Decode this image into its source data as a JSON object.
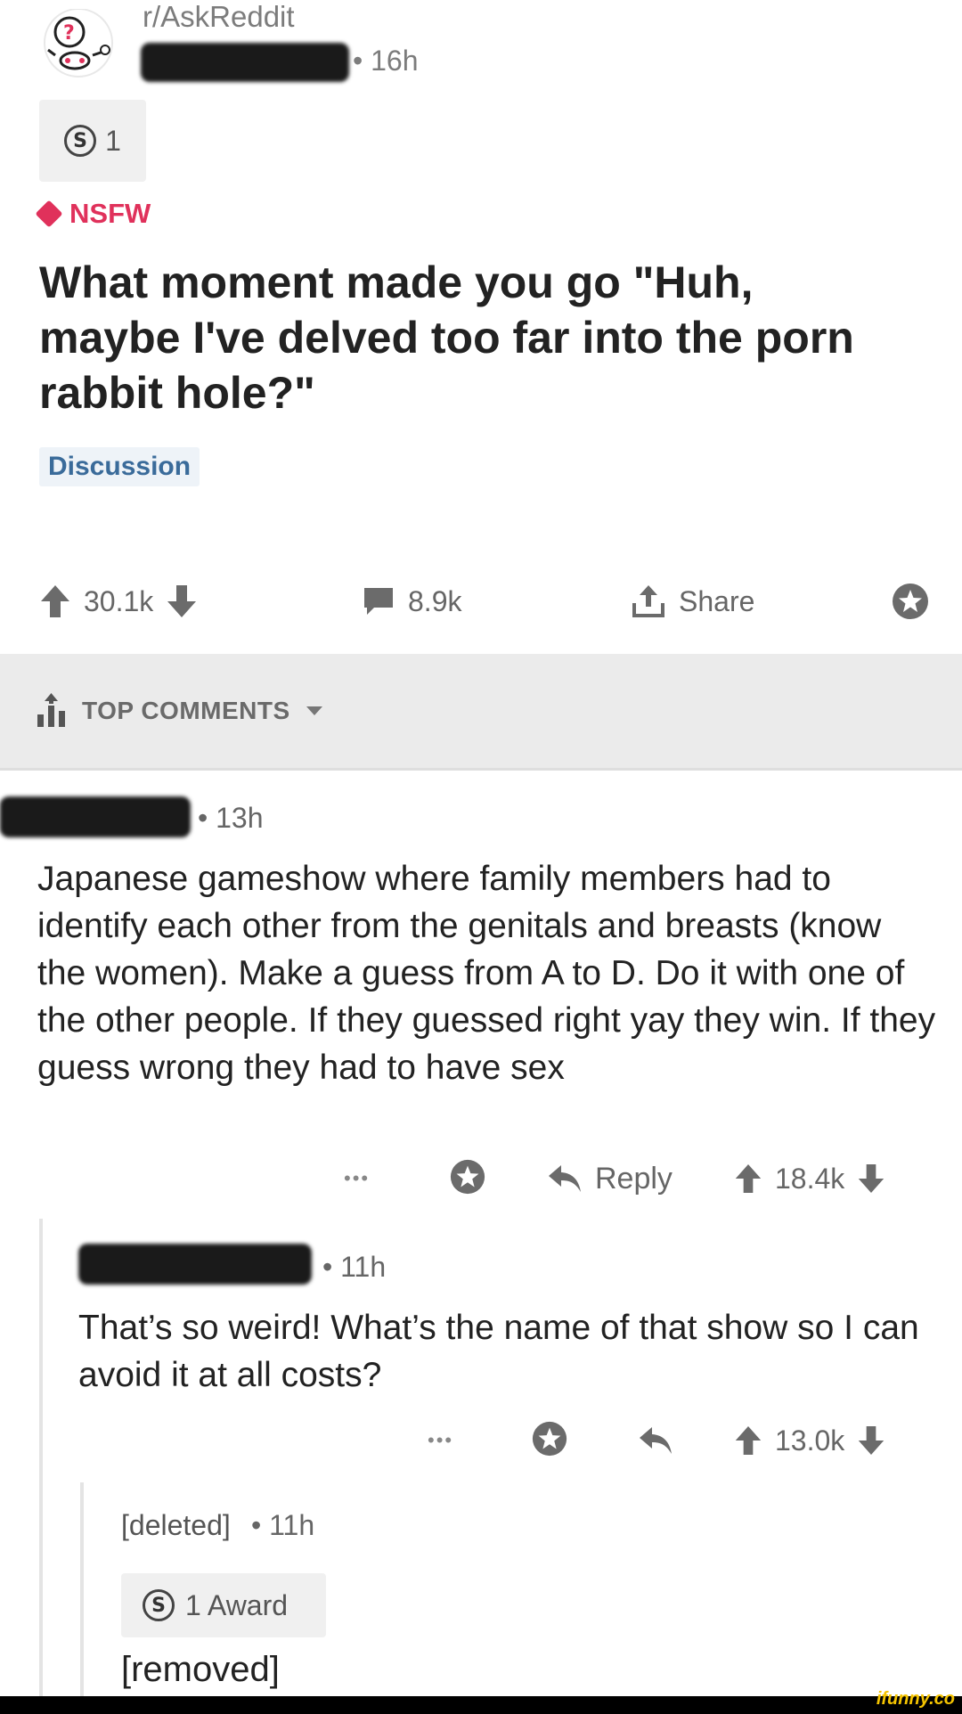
{
  "post": {
    "subreddit": "r/AskReddit",
    "author_age": "• 16h",
    "award_count": "1",
    "nsfw_label": "NSFW",
    "title": "What moment made you go \"Huh, maybe I've delved too far into the porn rabbit hole?\"",
    "flair": "Discussion",
    "upvotes": "30.1k",
    "comments": "8.9k",
    "share_label": "Share"
  },
  "sort_bar": {
    "label": "TOP COMMENTS"
  },
  "comments": [
    {
      "age": "• 13h",
      "text": "Japanese gameshow where family members had to identify each other from the genitals and breasts (know the women). Make a guess from A to D. Do it with one of the other people. If they guessed right yay they win. If they guess wrong they had to have sex",
      "more": "•••",
      "reply_label": "Reply",
      "score": "18.4k"
    },
    {
      "age": "• 11h",
      "text": "That’s so weird! What’s the name of that show so I can avoid it at all costs?",
      "more": "•••",
      "score": "13.0k"
    },
    {
      "author": "[deleted]",
      "age": "• 11h",
      "award_label": "1 Award",
      "text": "[removed]"
    }
  ],
  "watermark": "ifunny.co",
  "colors": {
    "nsfw": "#e0315b",
    "flair_text": "#3a6b9a",
    "icon_gray": "#6b6b6b"
  }
}
